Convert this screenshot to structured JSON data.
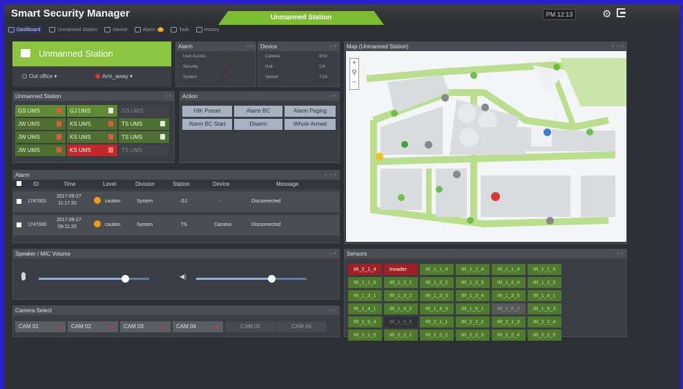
{
  "app": {
    "title": "Smart Security Manager",
    "station_tab": "Unmanned Station",
    "clock": "PM 12:13"
  },
  "nav": [
    {
      "label": "Dashboard",
      "active": true
    },
    {
      "label": "Unmanned Station"
    },
    {
      "label": "Device"
    },
    {
      "label": "Alarm",
      "badge": "5"
    },
    {
      "label": "Task"
    },
    {
      "label": "History"
    }
  ],
  "station": {
    "name": "Unmanned Station",
    "status": "Out office",
    "mode": "Arm_away"
  },
  "alarm_summary": {
    "title": "Alarm",
    "rows": [
      {
        "label": "User Access",
        "value": "-"
      },
      {
        "label": "Security",
        "value": "1"
      },
      {
        "label": "System",
        "value": "1"
      }
    ]
  },
  "device_summary": {
    "title": "Device",
    "rows": [
      {
        "label": "Camera",
        "value": "6/16"
      },
      {
        "label": "Hub",
        "value": "1/4"
      },
      {
        "label": "Sensor",
        "value": "7/16"
      }
    ]
  },
  "unmanned_panel": {
    "title": "Unmanned Station",
    "cells": [
      [
        "GS UMS",
        "GJ UMS",
        "GS UMS"
      ],
      [
        "JW UMS",
        "KS UMS",
        "TS UMS"
      ],
      [
        "JW UMS",
        "KS UMS",
        "TS UMS"
      ],
      [
        "JW UMS",
        "KS UMS",
        "TS UMS"
      ]
    ]
  },
  "action_panel": {
    "title": "Action",
    "buttons": [
      "HIK Preset",
      "Alarm BC",
      "Alarm Paging",
      "Alarm BC Start",
      "Disarm",
      "Whole Armed"
    ]
  },
  "alarm_table": {
    "title": "Alarm",
    "headers": {
      "id": "ID",
      "time": "Time",
      "level": "Level",
      "division": "Division",
      "station": "Station",
      "device": "Device",
      "message": "Message"
    },
    "rows": [
      {
        "id": "1747001",
        "date": "2017-09-27",
        "clock": "11:17:20",
        "level": "caution",
        "division": "System",
        "station": "GJ",
        "device": "-",
        "message": "Disconnected"
      },
      {
        "id": "1747000",
        "date": "2017-09-27",
        "clock": "09:11:20",
        "level": "caution",
        "division": "System",
        "station": "TS",
        "device": "Camera",
        "message": "Disconnected"
      }
    ]
  },
  "volume": {
    "title": "Speaker / MIC Volume",
    "mic_level": 0.78,
    "speaker_level": 0.68
  },
  "camera_select": {
    "title": "Camera Select",
    "cams": [
      "CAM 01",
      "CAM 02",
      "CAM 03",
      "CAM 04",
      "CAM 05",
      "CAM 06"
    ]
  },
  "map": {
    "title": "Map (Unmanned Station)"
  },
  "sensors": {
    "title": "Sensors",
    "cells": [
      "IR_2_1_4",
      "Invader",
      "IR_1_1_4",
      "IR_1_1_4",
      "IR_1_1_4",
      "IR_1_1_5",
      "IR_1_1_6",
      "IR_1_2_1",
      "IR_1_2_2",
      "IR_1_2_3",
      "IR_1_2_4",
      "IR_1_2_5",
      "IR_1_3_1",
      "IR_1_3_2",
      "IR_1_3_3",
      "IR_1_3_4",
      "IR_1_3_5",
      "IR_1_4_1",
      "IR_1_4_1",
      "IR_1_4_2",
      "IR_1_4_3",
      "IR_1_5_1",
      "IR_1_5_2",
      "IR_1_5_3",
      "IR_1_5_4",
      "IR_1_5_5",
      "IR_2_1_1",
      "IR_2_1_2",
      "IR_2_1_3",
      "IR_2_1_4",
      "IR_2_1_5",
      "IR_2_2_1",
      "IR_2_2_2",
      "IR_2_2_3",
      "IR_2_2_4",
      "IR_2_2_5"
    ]
  }
}
